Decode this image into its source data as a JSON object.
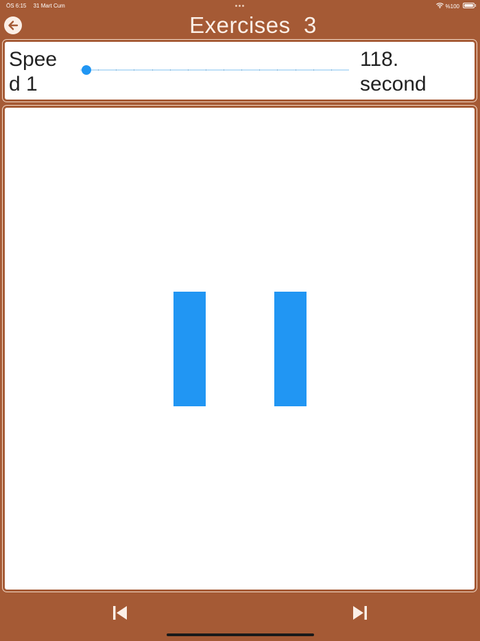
{
  "status_bar": {
    "time": "ÖS 6:15",
    "date": "31 Mart Cum",
    "battery": "%100",
    "battery_level": 1.0
  },
  "header": {
    "title": "Exercises  3",
    "back_icon": "arrow-left-icon"
  },
  "speed": {
    "label": "Speed 1",
    "slider_value": 1,
    "slider_position": 0,
    "time_readout": "118. second"
  },
  "exercise": {
    "bar_color": "#2196f3",
    "bar_count": 2
  },
  "toolbar": {
    "previous_icon": "skip-previous-icon",
    "next_icon": "skip-next-icon"
  },
  "colors": {
    "brand": "#a55a35",
    "accent": "#2196f3",
    "title_text": "#fbefe7"
  }
}
